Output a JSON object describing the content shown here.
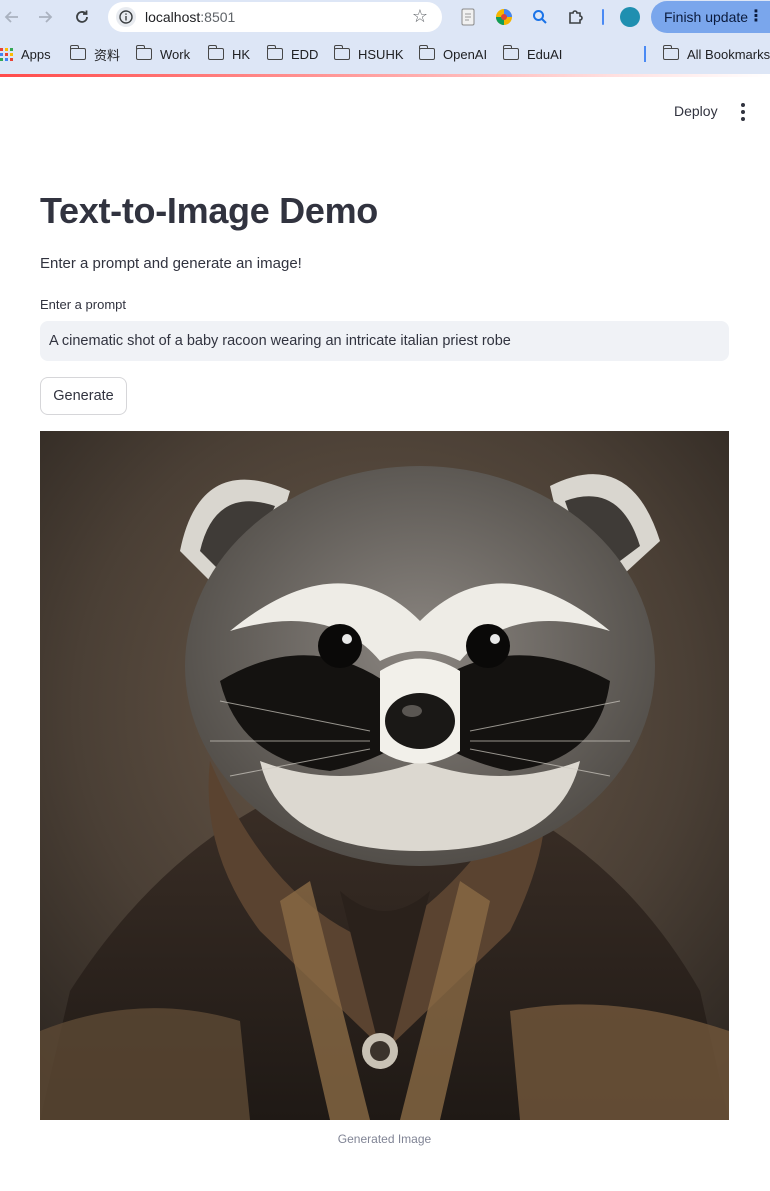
{
  "browser": {
    "url_host": "localhost",
    "url_port": ":8501",
    "update_label": "Finish update",
    "bookmarks": [
      "Apps",
      "资料",
      "Work",
      "HK",
      "EDD",
      "HSUHK",
      "OpenAI",
      "EduAI"
    ],
    "all_bookmarks_label": "All Bookmarks"
  },
  "app": {
    "deploy_label": "Deploy",
    "title": "Text-to-Image Demo",
    "subtitle": "Enter a prompt and generate an image!",
    "prompt_label": "Enter a prompt",
    "prompt_value": "A cinematic shot of a baby racoon wearing an intricate italian priest robe",
    "generate_label": "Generate",
    "image_caption": "Generated Image"
  },
  "colors": {
    "primary_accent": "#ff4b4b",
    "text": "#31333f",
    "input_bg": "#f0f2f6",
    "chrome_bg": "#dde6f6"
  }
}
